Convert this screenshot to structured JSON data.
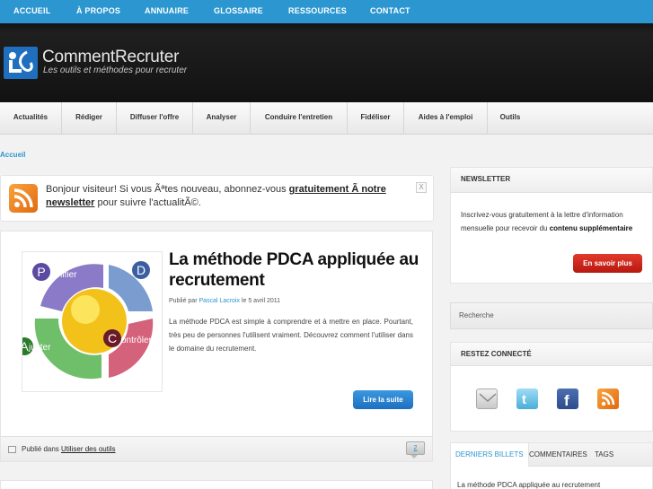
{
  "topnav": {
    "items": [
      "ACCUEIL",
      "À PROPOS",
      "ANNUAIRE",
      "GLOSSAIRE",
      "RESSOURCES",
      "CONTACT"
    ]
  },
  "header": {
    "title": "CommentRecruter",
    "tagline": "Les outils et méthodes pour recruter"
  },
  "subnav": {
    "items": [
      "Actualités",
      "Rédiger",
      "Diffuser l'offre",
      "Analyser",
      "Conduire l'entretien",
      "Fidéliser",
      "Aides à l'emploi",
      "Outils"
    ]
  },
  "breadcrumb": "Accueil",
  "welcome": {
    "before": "Bonjour visiteur! Si vous Ãªtes nouveau, abonnez-vous ",
    "link": "gratuitement Ã  notre newsletter",
    "after": " pour suivre l'actualitÃ©.",
    "close": "X"
  },
  "article": {
    "title": "La méthode PDCA appliquée au recrutement",
    "meta_prefix": "Publié par ",
    "author": "Pascal Lacroix",
    "meta_suffix": " le 5 avril 2011",
    "excerpt": "La méthode PDCA est simple à comprendre et à mettre en place. Pourtant, très peu de personnes l'utilisent vraiment. Découvrez comment l'utiliser dans le domaine du recrutement.",
    "read_more": "Lire la suite",
    "footer_prefix": "Publié dans ",
    "category": "Utiliser des outils",
    "comments": "2",
    "diagram": {
      "letters": [
        "P",
        "D",
        "C",
        "A"
      ],
      "words": [
        "lanifier",
        "évelopper",
        "ontrôler",
        "juster"
      ]
    }
  },
  "sidebar": {
    "newsletter": {
      "title": "NEWSLETTER",
      "text": "Inscrivez-vous gratuitement à la lettre d'information mensuelle pour recevoir du ",
      "bold": "contenu supplémentaire",
      "button": "En savoir plus"
    },
    "search_placeholder": "Recherche",
    "connect": {
      "title": "RESTEZ CONNECTÉ"
    },
    "tabs": [
      "DERNIERS BILLETS",
      "COMMENTAIRES",
      "TAGS"
    ],
    "latest": "La méthode PDCA appliquée au recrutement"
  },
  "colors": {
    "accent": "#2b96cf",
    "header_bg": "#171717",
    "button_red": "#c8231a",
    "button_blue": "#2a82d0"
  }
}
